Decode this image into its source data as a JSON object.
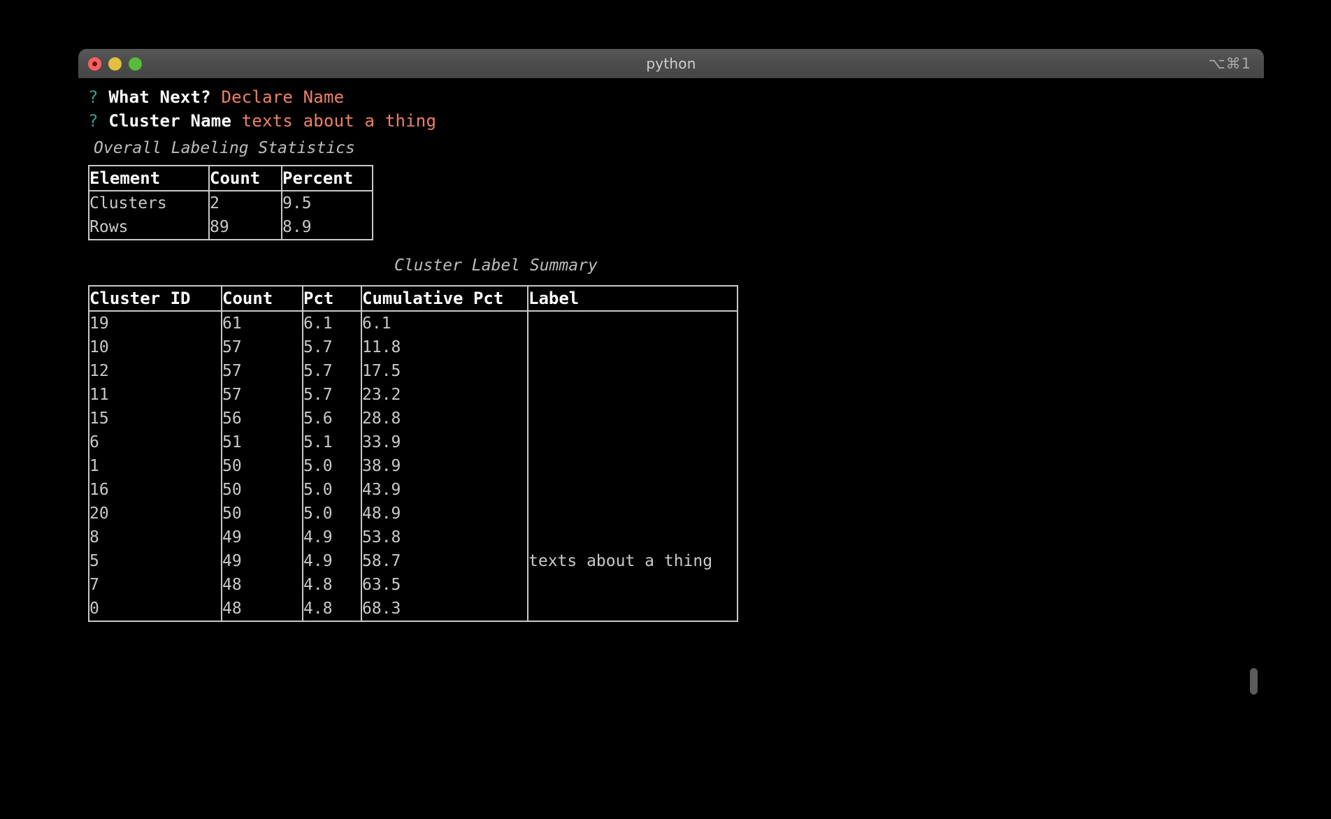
{
  "window": {
    "title": "python",
    "shortcut": "⌥⌘1",
    "traffic_lights": [
      "close",
      "minimize",
      "maximize"
    ]
  },
  "prompts": [
    {
      "marker": "?",
      "question": "What Next?",
      "answer": "Declare Name"
    },
    {
      "marker": "?",
      "question": "Cluster Name",
      "answer": "texts about a thing"
    }
  ],
  "overall": {
    "title": "Overall Labeling Statistics",
    "headers": [
      "Element",
      "Count",
      "Percent"
    ],
    "rows": [
      {
        "element": "Clusters",
        "count": "2",
        "percent": "9.5"
      },
      {
        "element": "Rows",
        "count": "89",
        "percent": "8.9"
      }
    ],
    "element_col": "Clusters\nRows",
    "count_col": "2\n89",
    "percent_col": "9.5\n8.9"
  },
  "summary": {
    "title": "Cluster Label Summary",
    "headers": [
      "Cluster ID",
      "Count",
      "Pct",
      "Cumulative Pct",
      "Label"
    ],
    "rows": [
      {
        "cluster_id": "19",
        "count": "61",
        "pct": "6.1",
        "cumulative_pct": "6.1",
        "label": ""
      },
      {
        "cluster_id": "10",
        "count": "57",
        "pct": "5.7",
        "cumulative_pct": "11.8",
        "label": ""
      },
      {
        "cluster_id": "12",
        "count": "57",
        "pct": "5.7",
        "cumulative_pct": "17.5",
        "label": ""
      },
      {
        "cluster_id": "11",
        "count": "57",
        "pct": "5.7",
        "cumulative_pct": "23.2",
        "label": ""
      },
      {
        "cluster_id": "15",
        "count": "56",
        "pct": "5.6",
        "cumulative_pct": "28.8",
        "label": ""
      },
      {
        "cluster_id": "6",
        "count": "51",
        "pct": "5.1",
        "cumulative_pct": "33.9",
        "label": ""
      },
      {
        "cluster_id": "1",
        "count": "50",
        "pct": "5.0",
        "cumulative_pct": "38.9",
        "label": ""
      },
      {
        "cluster_id": "16",
        "count": "50",
        "pct": "5.0",
        "cumulative_pct": "43.9",
        "label": ""
      },
      {
        "cluster_id": "20",
        "count": "50",
        "pct": "5.0",
        "cumulative_pct": "48.9",
        "label": ""
      },
      {
        "cluster_id": "8",
        "count": "49",
        "pct": "4.9",
        "cumulative_pct": "53.8",
        "label": ""
      },
      {
        "cluster_id": "5",
        "count": "49",
        "pct": "4.9",
        "cumulative_pct": "58.7",
        "label": "texts about a thing"
      },
      {
        "cluster_id": "7",
        "count": "48",
        "pct": "4.8",
        "cumulative_pct": "63.5",
        "label": ""
      },
      {
        "cluster_id": "0",
        "count": "48",
        "pct": "4.8",
        "cumulative_pct": "68.3",
        "label": ""
      }
    ],
    "cluster_id_col": "19\n10\n12\n11\n15\n6\n1\n16\n20\n8\n5\n7\n0",
    "count_col": "61\n57\n57\n57\n56\n51\n50\n50\n50\n49\n49\n48\n48",
    "pct_col": "6.1\n5.7\n5.7\n5.7\n5.6\n5.1\n5.0\n5.0\n5.0\n4.9\n4.9\n4.8\n4.8",
    "cumulative_pct_col": "6.1\n11.8\n17.5\n23.2\n28.8\n33.9\n38.9\n43.9\n48.9\n53.8\n58.7\n63.5\n68.3",
    "label_col": "\n\n\n\n\n\n\n\n\n\ntexts about a thing\n\n"
  },
  "colors": {
    "prompt_marker": "#2aa198",
    "prompt_answer": "#f08060",
    "text": "#c9c9c9",
    "border": "#c8c8c8",
    "background": "#000000",
    "titlebar": "#4b4b4b",
    "close": "#f9605e",
    "minimize": "#e3bf3e",
    "maximize": "#58bb39"
  }
}
